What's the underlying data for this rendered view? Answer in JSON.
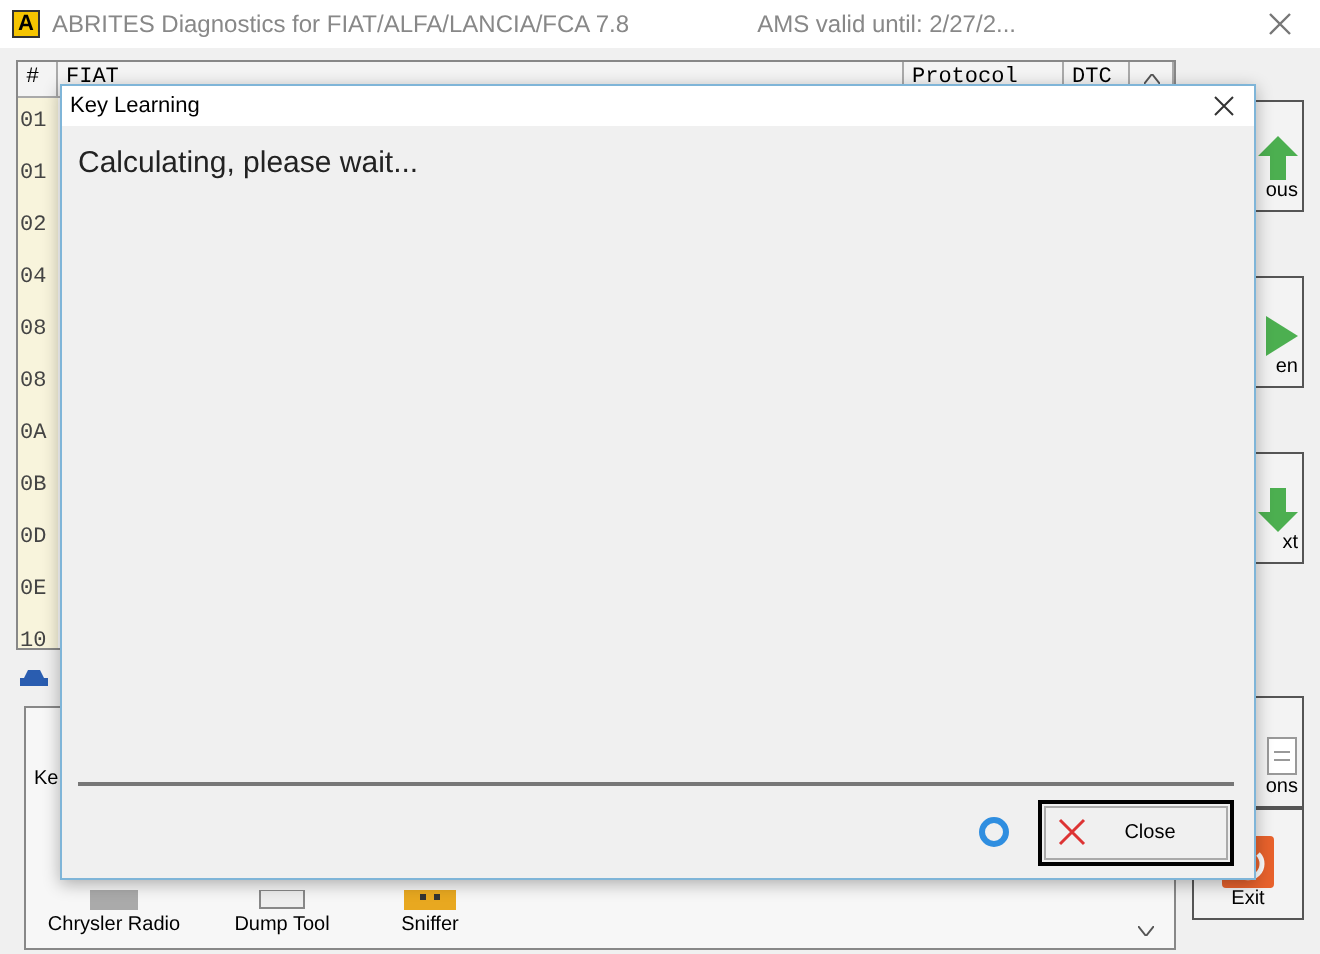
{
  "window": {
    "logo": "A",
    "title": "ABRITES Diagnostics for FIAT/ALFA/LANCIA/FCA 7.8",
    "license": "AMS valid until: 2/27/2..."
  },
  "table": {
    "columns": [
      "#",
      "FIAT",
      "Protocol",
      "DTC"
    ],
    "rows": [
      "01",
      "01",
      "02",
      "04",
      "08",
      "08",
      "0A",
      "0B",
      "0D",
      "0E",
      "10"
    ]
  },
  "side_buttons": [
    {
      "label": "ous",
      "kind": "up"
    },
    {
      "label": "en",
      "kind": "open"
    },
    {
      "label": "xt",
      "kind": "down"
    },
    {
      "label": "ons",
      "kind": "options"
    },
    {
      "label": "Exit",
      "kind": "exit"
    }
  ],
  "panel": {
    "label": "Ke",
    "tools": [
      {
        "label": "Chrysler Radio",
        "kind": "radio"
      },
      {
        "label": "Dump Tool",
        "kind": "dump"
      },
      {
        "label": "Sniffer",
        "kind": "sniffer"
      }
    ]
  },
  "dialog": {
    "title": "Key Learning",
    "message": "Calculating, please wait...",
    "busy": true,
    "button": "Close"
  }
}
